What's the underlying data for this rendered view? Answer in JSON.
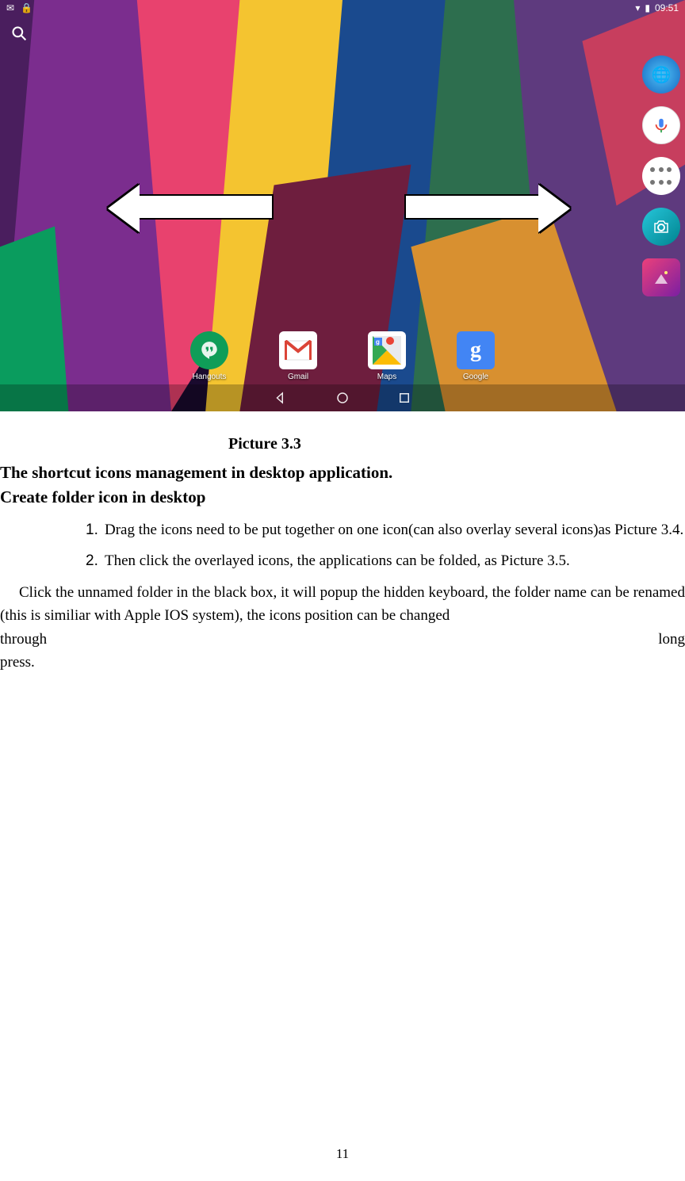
{
  "statusbar": {
    "left_icons": [
      "✉",
      "🔒"
    ],
    "wifi": "▾",
    "battery": "▮",
    "time": "09:51"
  },
  "dock": {
    "hangouts": "Hangouts",
    "gmail": "Gmail",
    "maps": "Maps",
    "google": "Google"
  },
  "caption": "Picture 3.3",
  "heading1": "The shortcut icons management in desktop application.",
  "heading2": "Create folder icon in desktop",
  "list": {
    "m1": "1.",
    "item1": "Drag the icons need to be put together on one icon(can also overlay several icons)as Picture 3.4.",
    "m2": "2.",
    "item2": "Then click the overlayed icons, the applications can be folded, as Picture 3.5."
  },
  "para_main": "Click the unnamed folder in the black box, it will popup the hidden keyboard, the folder name can be renamed (this is similiar with Apple IOS system), the icons position can be changed",
  "para_through": "through",
  "para_long": "long",
  "para_press": "press.",
  "page_number": "11"
}
